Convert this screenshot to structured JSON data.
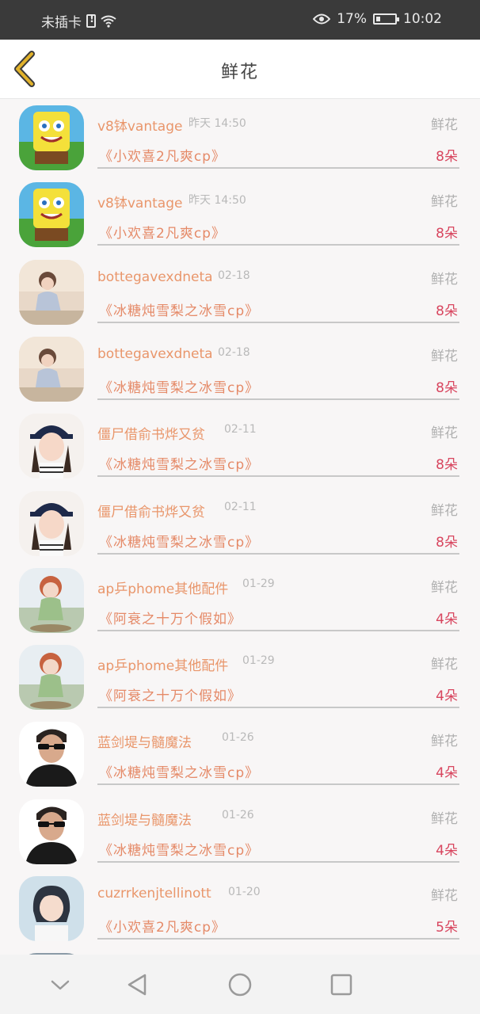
{
  "status_bar": {
    "carrier": "未插卡",
    "battery_percent": "17%",
    "time": "10:02",
    "icons": [
      "sim-icon",
      "wifi-icon",
      "eye-icon",
      "battery-icon"
    ]
  },
  "header": {
    "title": "鲜花",
    "back_icon": "chevron-left-icon",
    "back_color": "#e1b22b"
  },
  "colors": {
    "name": "#e9966b",
    "gift": "#e58a68",
    "count": "#d8465f",
    "muted": "#b9b9b9"
  },
  "rows": [
    {
      "name": "v8钵vantage",
      "time": "昨天 14:50",
      "type": "鲜花",
      "gift": "《小欢喜2凡爽cp》",
      "count": "8朵",
      "avatar": "spongebob"
    },
    {
      "name": "v8钵vantage",
      "time": "昨天 14:50",
      "type": "鲜花",
      "gift": "《小欢喜2凡爽cp》",
      "count": "8朵",
      "avatar": "spongebob"
    },
    {
      "name": "bottegavexdneta",
      "time": "02-18",
      "type": "鲜花",
      "gift": "《冰糖炖雪梨之冰雪cp》",
      "count": "8朵",
      "avatar": "sitting-girl"
    },
    {
      "name": "bottegavexdneta",
      "time": "02-18",
      "type": "鲜花",
      "gift": "《冰糖炖雪梨之冰雪cp》",
      "count": "8朵",
      "avatar": "sitting-girl"
    },
    {
      "name": "僵尸借俞书烨又贫",
      "time": "02-11",
      "type": "鲜花",
      "gift": "《冰糖炖雪梨之冰雪cp》",
      "count": "8朵",
      "avatar": "cap-girl"
    },
    {
      "name": "僵尸借俞书烨又贫",
      "time": "02-11",
      "type": "鲜花",
      "gift": "《冰糖炖雪梨之冰雪cp》",
      "count": "8朵",
      "avatar": "cap-girl"
    },
    {
      "name": "ap乒phome其他配件",
      "time": "01-29",
      "type": "鲜花",
      "gift": "《阿衰之十万个假如》",
      "count": "4朵",
      "avatar": "doll"
    },
    {
      "name": "ap乒phome其他配件",
      "time": "01-29",
      "type": "鲜花",
      "gift": "《阿衰之十万个假如》",
      "count": "4朵",
      "avatar": "doll"
    },
    {
      "name": "蓝剑堤与髓魔法",
      "time": "01-26",
      "type": "鲜花",
      "gift": "《冰糖炖雪梨之冰雪cp》",
      "count": "4朵",
      "avatar": "sunglasses-man"
    },
    {
      "name": "蓝剑堤与髓魔法",
      "time": "01-26",
      "type": "鲜花",
      "gift": "《冰糖炖雪梨之冰雪cp》",
      "count": "4朵",
      "avatar": "sunglasses-man"
    },
    {
      "name": "cuzrrkenjtellinott",
      "time": "01-20",
      "type": "鲜花",
      "gift": "《小欢喜2凡爽cp》",
      "count": "5朵",
      "avatar": "bob-girl"
    }
  ],
  "nav_bar": {
    "buttons": [
      "chevron-down-icon",
      "back-triangle-icon",
      "home-circle-icon",
      "recents-square-icon"
    ]
  }
}
